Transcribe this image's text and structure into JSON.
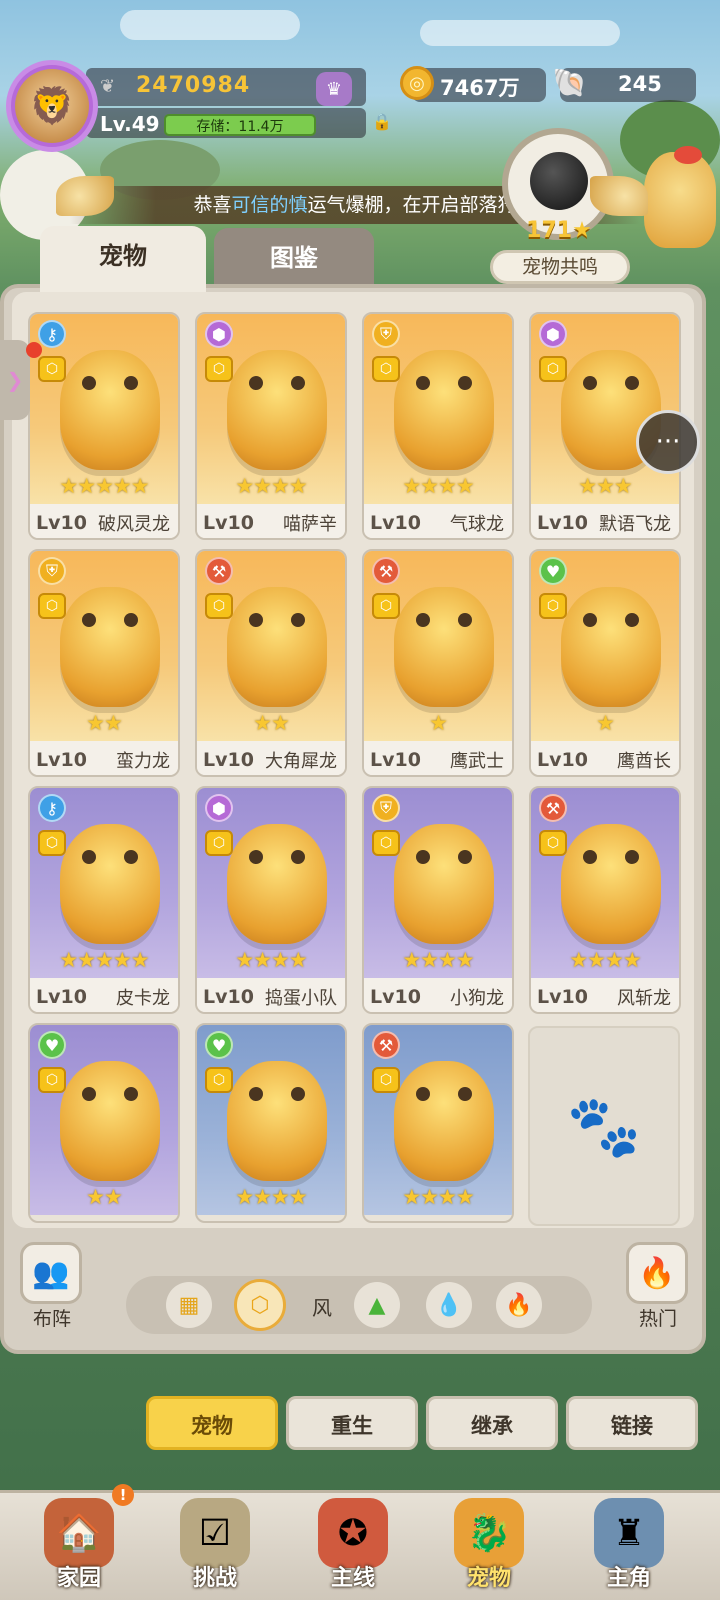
{
  "header": {
    "power": "2470984",
    "level": "Lv.49",
    "storage": "存储：11.4万",
    "gold": "7467万",
    "shells": "245"
  },
  "announcement": {
    "prefix": "恭喜",
    "name": "可信的慎",
    "suffix": "运气爆棚，在开启部落狩"
  },
  "resonance": {
    "count": "171",
    "label": "宠物共鸣"
  },
  "tabs": {
    "pet": "宠物",
    "dex": "图鉴"
  },
  "pets": [
    {
      "level": "Lv10",
      "name": "破风灵龙",
      "stars": "★★★★★",
      "bg": "orange",
      "type": "key",
      "type_color": "#3fa0e6"
    },
    {
      "level": "Lv10",
      "name": "喵萨辛",
      "stars": "★★★★",
      "bg": "orange",
      "type": "gem",
      "type_color": "#b56ad6"
    },
    {
      "level": "Lv10",
      "name": "气球龙",
      "stars": "★★★★",
      "bg": "orange",
      "type": "shield",
      "type_color": "#f0b020"
    },
    {
      "level": "Lv10",
      "name": "默语飞龙",
      "stars": "★★★",
      "bg": "orange",
      "type": "gem",
      "type_color": "#b56ad6"
    },
    {
      "level": "Lv10",
      "name": "蛮力龙",
      "stars": "★★",
      "bg": "orange",
      "type": "shield",
      "type_color": "#f0b020"
    },
    {
      "level": "Lv10",
      "name": "大角犀龙",
      "stars": "★★",
      "bg": "orange",
      "type": "axe",
      "type_color": "#e35a3a"
    },
    {
      "level": "Lv10",
      "name": "鹰武士",
      "stars": "★",
      "bg": "orange",
      "type": "axe",
      "type_color": "#e35a3a"
    },
    {
      "level": "Lv10",
      "name": "鹰酋长",
      "stars": "★",
      "bg": "orange",
      "type": "heart",
      "type_color": "#5bc24a"
    },
    {
      "level": "Lv10",
      "name": "皮卡龙",
      "stars": "★★★★★",
      "bg": "purple",
      "type": "key",
      "type_color": "#3fa0e6"
    },
    {
      "level": "Lv10",
      "name": "捣蛋小队",
      "stars": "★★★★",
      "bg": "purple",
      "type": "gem",
      "type_color": "#b56ad6"
    },
    {
      "level": "Lv10",
      "name": "小狗龙",
      "stars": "★★★★",
      "bg": "purple",
      "type": "shield",
      "type_color": "#f0b020"
    },
    {
      "level": "Lv10",
      "name": "风斩龙",
      "stars": "★★★★",
      "bg": "purple",
      "type": "axe",
      "type_color": "#e35a3a"
    },
    {
      "level": "",
      "name": "",
      "stars": "★★",
      "bg": "purple",
      "type": "heart",
      "type_color": "#5bc24a"
    },
    {
      "level": "",
      "name": "",
      "stars": "★★★★",
      "bg": "blue",
      "type": "heart",
      "type_color": "#5bc24a"
    },
    {
      "level": "",
      "name": "",
      "stars": "★★★★",
      "bg": "blue",
      "type": "axe",
      "type_color": "#e35a3a"
    }
  ],
  "filters": {
    "formation": "布阵",
    "wind_label": "风",
    "hot": "热门"
  },
  "sub_tabs": [
    "宠物",
    "重生",
    "继承",
    "链接"
  ],
  "nav": [
    "家园",
    "挑战",
    "主线",
    "宠物",
    "主角"
  ],
  "nav_alert": "!"
}
